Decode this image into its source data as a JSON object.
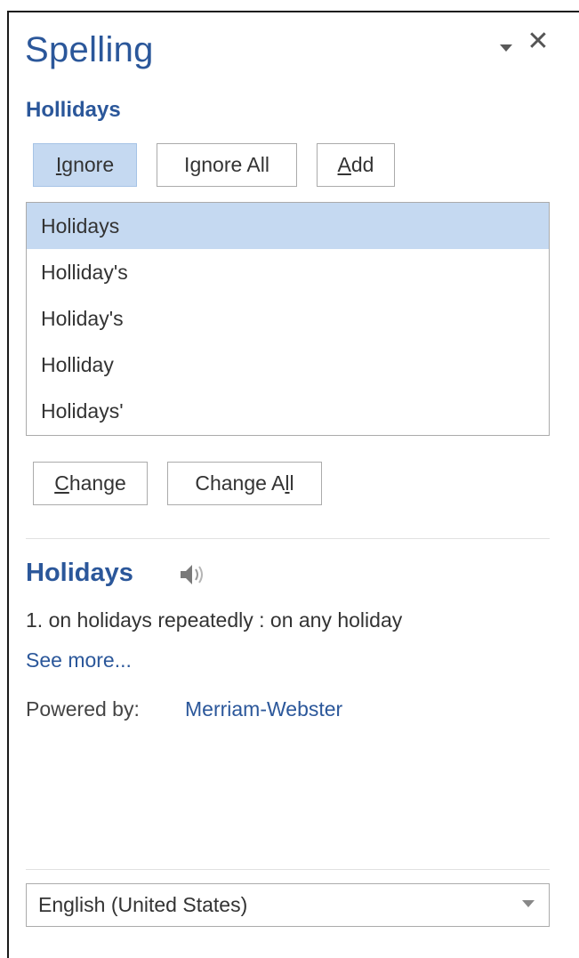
{
  "pane": {
    "title": "Spelling",
    "menu_icon": "chevron-down-icon",
    "close_icon": "close-icon",
    "close_glyph": "✕"
  },
  "misspelled_word": "Hollidays",
  "actions": {
    "ignore": {
      "pre": "",
      "key": "I",
      "post": "gnore"
    },
    "ignore_all": {
      "pre": "I",
      "key": "g",
      "post": "nore All"
    },
    "add": {
      "pre": "",
      "key": "A",
      "post": "dd"
    }
  },
  "suggestions": [
    "Holidays",
    "Holliday's",
    "Holiday's",
    "Holliday",
    "Holidays'"
  ],
  "selected_suggestion": "Holidays",
  "change_actions": {
    "change": {
      "pre": "",
      "key": "C",
      "post": "hange"
    },
    "change_all": {
      "pre": "Change A",
      "key": "l",
      "post": "l"
    }
  },
  "dictionary": {
    "word": "Holidays",
    "speaker_icon": "speaker-icon",
    "definition": "1. on holidays repeatedly : on any holiday",
    "see_more": "See more...",
    "powered_by_label": "Powered by:",
    "provider": "Merriam-Webster"
  },
  "language": {
    "selected": "English (United States)"
  },
  "colors": {
    "accent": "#2b579a",
    "selected_bg": "#c5d9f1",
    "border": "#ababab"
  }
}
